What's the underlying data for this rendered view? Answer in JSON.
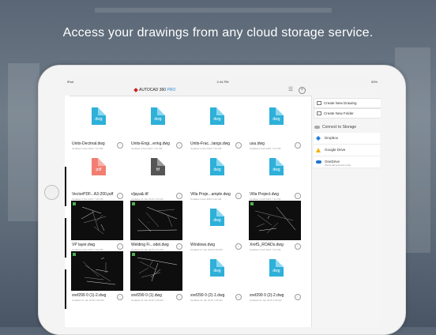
{
  "headline": "Access your drawings from any cloud storage service.",
  "status_bar": {
    "device": "iPad",
    "time": "2:44 PM",
    "battery": "53%"
  },
  "app": {
    "brand": "AUTODESK",
    "name": "AUTOCAD",
    "version": "360",
    "edition": "PRO"
  },
  "files": [
    {
      "name": "Units-Decimal.dwg",
      "meta": "Updated 4 Feb 2015 7:16 PM",
      "type": "dwg",
      "thumb": "icon"
    },
    {
      "name": "Units-Engi...ering.dwg",
      "meta": "Updated 4 Feb 2015 7:16 PM",
      "type": "dwg",
      "thumb": "icon"
    },
    {
      "name": "Units-Frac...tangs.dwg",
      "meta": "Updated 4 Feb 2015 7:16 PM",
      "type": "dwg",
      "thumb": "icon"
    },
    {
      "name": "uuu.dwg",
      "meta": "Updated 2 Feb 2015 7:21 PM",
      "type": "dwg",
      "thumb": "icon"
    },
    {
      "name": "VectorPDF...A3-200.pdf",
      "meta": "Updated 4 Feb 2015 7:16 PM",
      "type": "pdf",
      "thumb": "icon"
    },
    {
      "name": "vljaya&.ttf",
      "meta": "Updated 26 Jan 2015 1:29 AM",
      "type": "ttf",
      "thumb": "icon"
    },
    {
      "name": "Villa Proje...ample.dwg",
      "meta": "Updated 4 Feb 2015 4:12 AM",
      "type": "dwg",
      "thumb": "icon"
    },
    {
      "name": "Villa Project.dwg",
      "meta": "Updated 4 Feb 2015 7:16 PM",
      "type": "dwg",
      "thumb": "icon"
    },
    {
      "name": "VP layer.dwg",
      "meta": "Updated 4 Feb 2015 7:16 PM",
      "type": "dwg",
      "thumb": "cad"
    },
    {
      "name": "Welding Fi...odel.dwg",
      "meta": "Updated 26 Jan 2015 4:27 AM",
      "type": "dwg",
      "thumb": "cad"
    },
    {
      "name": "Windows.dwg",
      "meta": "Updated 27 Jan 2015 5:59 PM",
      "type": "dwg",
      "thumb": "icon"
    },
    {
      "name": "XrefS_ROADs.dwg",
      "meta": "Updated 4 Feb 2015 7:16 PM",
      "type": "dwg",
      "thumb": "cad"
    },
    {
      "name": "xref299 0 (1)-2.dwg",
      "meta": "Updated 21 Jan 2015 1:09 AM",
      "type": "dwg",
      "thumb": "cad"
    },
    {
      "name": "xref299 0 (1).dwg",
      "meta": "Updated 21 Jan 2015 1:09 AM",
      "type": "dwg",
      "thumb": "cad"
    },
    {
      "name": "xref299 0 (2)-1.dwg",
      "meta": "Updated 21 Jan 2015 1:09 AM",
      "type": "dwg",
      "thumb": "icon"
    },
    {
      "name": "xref299 0 (2)-2.dwg",
      "meta": "Updated 21 Jan 2015 1:09 AM",
      "type": "dwg",
      "thumb": "icon"
    }
  ],
  "sidebar": {
    "create_drawing": "Create New Drawing",
    "create_folder": "Create New Folder",
    "connect_heading": "Connect to Storage",
    "services": [
      {
        "label": "Dropbox",
        "sub": "",
        "color": "#1b7fe3"
      },
      {
        "label": "Google Drive",
        "sub": "",
        "color": "#f4b400"
      },
      {
        "label": "OneDrive",
        "sub": "(Personal accounts only)",
        "color": "#1e74d4"
      }
    ]
  },
  "colors": {
    "dwg": "#2eb0d9",
    "pdf": "#f27e73",
    "accent": "#c9221f"
  }
}
